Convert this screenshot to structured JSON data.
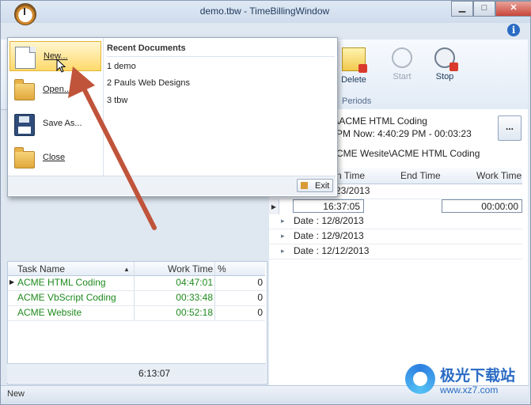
{
  "window": {
    "title": "demo.tbw - TimeBillingWindow",
    "min_glyph": "▁",
    "max_glyph": "□",
    "close_glyph": "✕",
    "help_glyph": "i"
  },
  "ribbon": {
    "buttons": [
      {
        "label": "Delete",
        "icon": "delete-period-icon",
        "enabled": true
      },
      {
        "label": "Start",
        "icon": "stopwatch-icon",
        "enabled": false
      },
      {
        "label": "Stop",
        "icon": "stopwatch-stop-icon",
        "enabled": true
      }
    ],
    "group_label": "Periods"
  },
  "info": {
    "line1": "\\ACME HTML Coding",
    "line2": "PM Now: 4:40:29 PM - 00:03:23",
    "line3": "CME Wesite\\ACME HTML Coding",
    "dots_label": "..."
  },
  "periods_grid": {
    "headers": [
      "n Time",
      "End Time",
      "Work Time"
    ],
    "rows": [
      {
        "text": "23/2013"
      },
      {
        "start": "",
        "end": "16:37:05",
        "work": "00:00:00"
      },
      {
        "text": "Date : 12/8/2013"
      },
      {
        "text": "Date : 12/9/2013"
      },
      {
        "text": "Date : 12/12/2013"
      }
    ],
    "expand_glyph": "▸",
    "current_glyph": "▶"
  },
  "tasks_grid": {
    "headers": {
      "name": "Task Name",
      "work": "Work Time",
      "pct": "%"
    },
    "sort_glyph": "▲",
    "rows": [
      {
        "name": "ACME HTML Coding",
        "work": "04:47:01",
        "pct": "0"
      },
      {
        "name": "ACME VbScript Coding",
        "work": "00:33:48",
        "pct": "0"
      },
      {
        "name": "ACME Website",
        "work": "00:52:18",
        "pct": "0"
      }
    ],
    "total": "6:13:07"
  },
  "app_menu": {
    "items": [
      {
        "label": "New...",
        "icon": "new-document-icon"
      },
      {
        "label": "Open...",
        "icon": "open-folder-icon"
      },
      {
        "label": "Save As...",
        "icon": "save-as-icon"
      },
      {
        "label": "Close",
        "icon": "close-folder-icon"
      }
    ],
    "recent_title": "Recent Documents",
    "recent": [
      "1 demo",
      "2 Pauls Web Designs",
      "3 tbw"
    ],
    "exit_label": "Exit"
  },
  "status": {
    "text": "New"
  },
  "watermark": {
    "name": "极光下载站",
    "url": "www.xz7.com"
  },
  "colors": {
    "task_text": "#1e8a1e",
    "highlight": "#ffd96b",
    "arrow": "#c0543a",
    "accent": "#2a6bc4"
  }
}
